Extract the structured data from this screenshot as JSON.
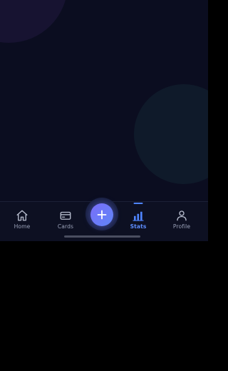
{
  "tabbar": {
    "items": [
      {
        "label": "Home",
        "icon": "home-icon",
        "active": false
      },
      {
        "label": "Cards",
        "icon": "card-icon",
        "active": false
      },
      {
        "label": "Stats",
        "icon": "bar-chart-icon",
        "active": true
      },
      {
        "label": "Profile",
        "icon": "user-icon",
        "active": false
      }
    ],
    "fab": {
      "icon": "plus-icon"
    }
  },
  "colors": {
    "background": "#0b0d20",
    "accent": "#5d8dff",
    "fab_gradient_start": "#7a6df8",
    "fab_gradient_end": "#5f86f7",
    "inactive": "#9aa1b8"
  }
}
